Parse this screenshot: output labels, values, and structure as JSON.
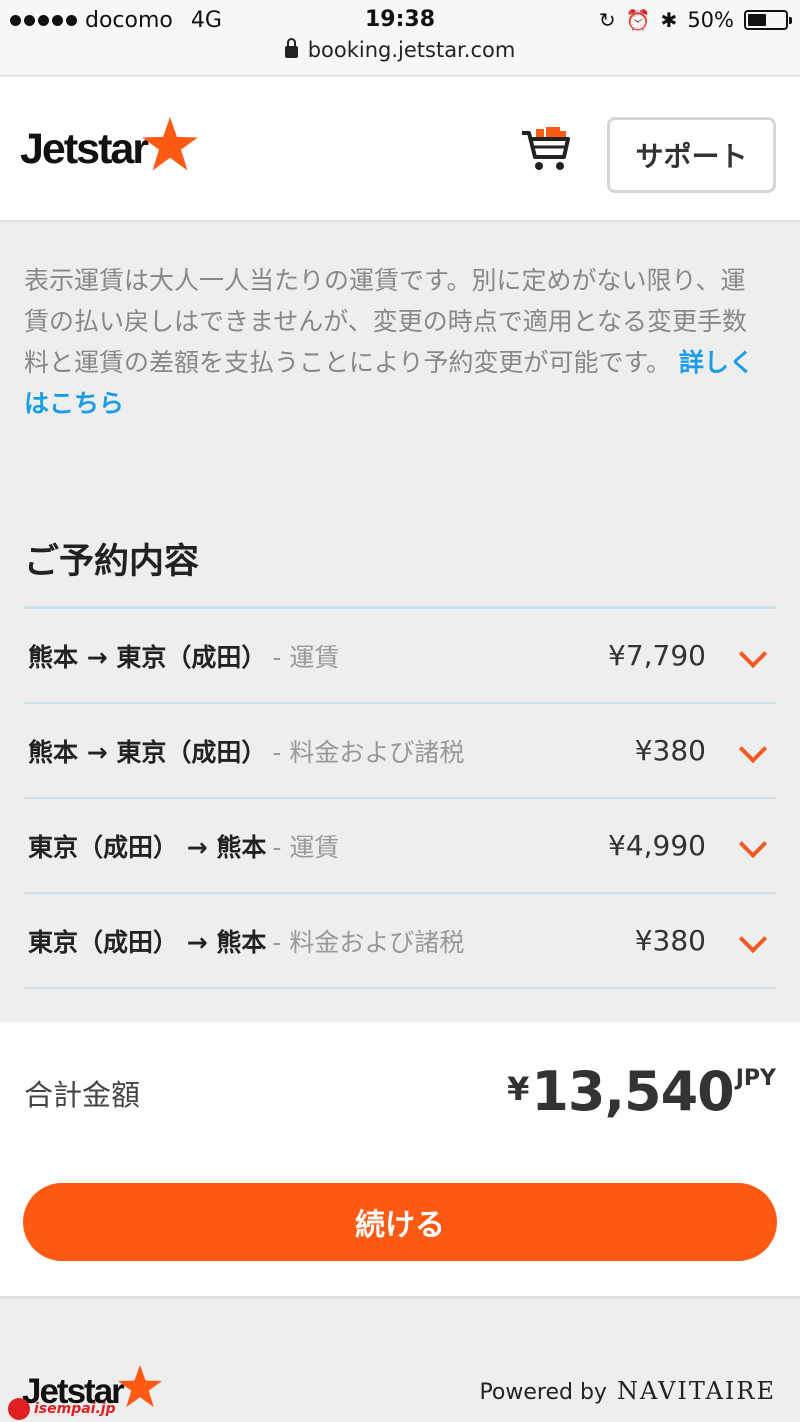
{
  "status_bar": {
    "carrier": "docomo",
    "network": "4G",
    "time": "19:38",
    "battery": "50%",
    "battery_level": 0.5,
    "url": "booking.jetstar.com"
  },
  "header": {
    "logo_text": "Jetstar",
    "support_label": "サポート",
    "brand_color": "#ff5a14"
  },
  "notice": {
    "text": "表示運賃は大人一人当たりの運賃です。別に定めがない限り、運賃の払い戻しはできませんが、変更の時点で適用となる変更手数料と運賃の差額を支払うことにより予約変更が可能です。",
    "link": "詳しくはこちら"
  },
  "booking": {
    "title": "ご予約内容",
    "rows": [
      {
        "route": "熊本 → 東京（成田）",
        "type": "- 運賃",
        "price": "¥7,790"
      },
      {
        "route": "熊本 → 東京（成田）",
        "type": "- 料金および諸税",
        "price": "¥380"
      },
      {
        "route": "東京（成田） → 熊本",
        "type": "- 運賃",
        "price": "¥4,990"
      },
      {
        "route": "東京（成田） → 熊本",
        "type": "- 料金および諸税",
        "price": "¥380"
      }
    ]
  },
  "total": {
    "label": "合計金額",
    "yen": "¥",
    "amount": "13,540",
    "currency": "JPY"
  },
  "continue_label": "続ける",
  "footer": {
    "logo_text": "Jetstar",
    "watermark": "isempai.jp",
    "powered_by": "Powered by",
    "navitaire": "NAVITAIRE"
  }
}
